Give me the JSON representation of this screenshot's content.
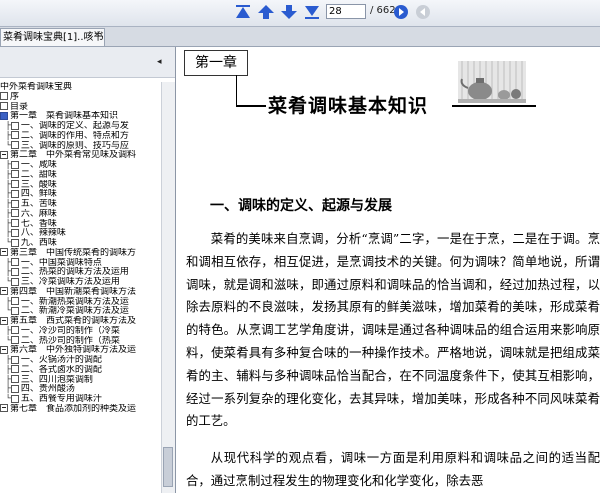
{
  "toolbar": {
    "page_current": "28",
    "page_total": "/ 662",
    "icons": [
      "first-page-icon",
      "prev-page-icon",
      "next-page-icon",
      "last-page-icon",
      "go-forward-icon",
      "go-back-icon"
    ]
  },
  "tab": {
    "title": "菜肴调味宝典[1]..咳书....",
    "close": "×"
  },
  "sidebar": {
    "collapse": "◂",
    "items": [
      {
        "text": "中外菜肴调味宝典",
        "prefix": "",
        "box": ""
      },
      {
        "text": "序",
        "prefix": "",
        "box": "plain"
      },
      {
        "text": "目录",
        "prefix": "",
        "box": "plain"
      },
      {
        "text": "第一章　菜肴调味基本知识",
        "prefix": "",
        "box": "filled"
      },
      {
        "text": "一、调味的定义、起源与发",
        "prefix": "├",
        "box": "plain"
      },
      {
        "text": "二、调味的作用、特点和方",
        "prefix": "├",
        "box": "plain"
      },
      {
        "text": "三、调味的原则、技巧与应",
        "prefix": "└",
        "box": "plain"
      },
      {
        "text": "第二章　中外菜肴常见味及调料",
        "prefix": "",
        "box": "minus"
      },
      {
        "text": "一、咸味",
        "prefix": "├",
        "box": "plain"
      },
      {
        "text": "二、甜味",
        "prefix": "├",
        "box": "plain"
      },
      {
        "text": "三、酸味",
        "prefix": "├",
        "box": "plain"
      },
      {
        "text": "四、鲜味",
        "prefix": "├",
        "box": "plain"
      },
      {
        "text": "五、苦味",
        "prefix": "├",
        "box": "plain"
      },
      {
        "text": "六、麻味",
        "prefix": "├",
        "box": "plain"
      },
      {
        "text": "七、香味",
        "prefix": "├",
        "box": "plain"
      },
      {
        "text": "八、辣辣味",
        "prefix": "├",
        "box": "plain"
      },
      {
        "text": "九、西味",
        "prefix": "└",
        "box": "plain"
      },
      {
        "text": "第三章　中国传统菜肴的调味方",
        "prefix": "",
        "box": "minus"
      },
      {
        "text": "一、中国菜调味特点",
        "prefix": "├",
        "box": "plain"
      },
      {
        "text": "二、热菜的调味方法及运用",
        "prefix": "├",
        "box": "plain"
      },
      {
        "text": "三、冷菜调味方法及运用",
        "prefix": "└",
        "box": "plain"
      },
      {
        "text": "第四章　中国新潮菜肴调味方法",
        "prefix": "",
        "box": "minus"
      },
      {
        "text": "一、新潮热菜调味方法及运",
        "prefix": "├",
        "box": "plain"
      },
      {
        "text": "二、新潮冷菜调味方法及运",
        "prefix": "└",
        "box": "plain"
      },
      {
        "text": "第五章　西式菜肴的调味方法及",
        "prefix": "",
        "box": "minus"
      },
      {
        "text": "一、冷沙司的制作（冷菜",
        "prefix": "├",
        "box": "plain"
      },
      {
        "text": "二、热沙司的制作（热菜",
        "prefix": "└",
        "box": "plain"
      },
      {
        "text": "第六章　中外独特调味方法及运",
        "prefix": "",
        "box": "minus"
      },
      {
        "text": "一、火锅汤汁的调配",
        "prefix": "├",
        "box": "plain"
      },
      {
        "text": "二、各式卤水的调配",
        "prefix": "├",
        "box": "plain"
      },
      {
        "text": "三、四川泡菜调制",
        "prefix": "├",
        "box": "plain"
      },
      {
        "text": "四、贵州酸汤",
        "prefix": "├",
        "box": "plain"
      },
      {
        "text": "五、西餐专用调味汁",
        "prefix": "└",
        "box": "plain"
      },
      {
        "text": "第七章　食品添加剂的种类及运",
        "prefix": "",
        "box": "minus"
      }
    ]
  },
  "doc": {
    "chapter_label": "第一章",
    "chapter_title": "菜肴调味基本知识",
    "section_title": "一、调味的定义、起源与发展",
    "paragraph1": "菜肴的美味来自烹调，分析“烹调”二字，一是在于烹，二是在于调。烹和调相互依存，相互促进，是烹调技术的关键。何为调味？简单地说，所谓调味，就是调和滋味，即通过原料和调味品的恰当调和，经过加热过程，以除去原料的不良滋味，发扬其原有的鲜美滋味，增加菜肴的美味，形成菜肴的特色。从烹调工艺学角度讲，调味是通过各种调味品的组合运用来影响原料，使菜肴具有多种复合味的一种操作技术。严格地说，调味就是把组成菜肴的主、辅料与多种调味品恰当配合，在不同温度条件下，使其互相影响，经过一系列复杂的理化变化，去其异味，增加美味，形成各种不同风味菜肴的工艺。",
    "paragraph2": "从现代科学的观点看，调味一方面是利用原料和调味品之间的适当配合，通过烹制过程发生的物理变化和化学变化，除去恶"
  }
}
